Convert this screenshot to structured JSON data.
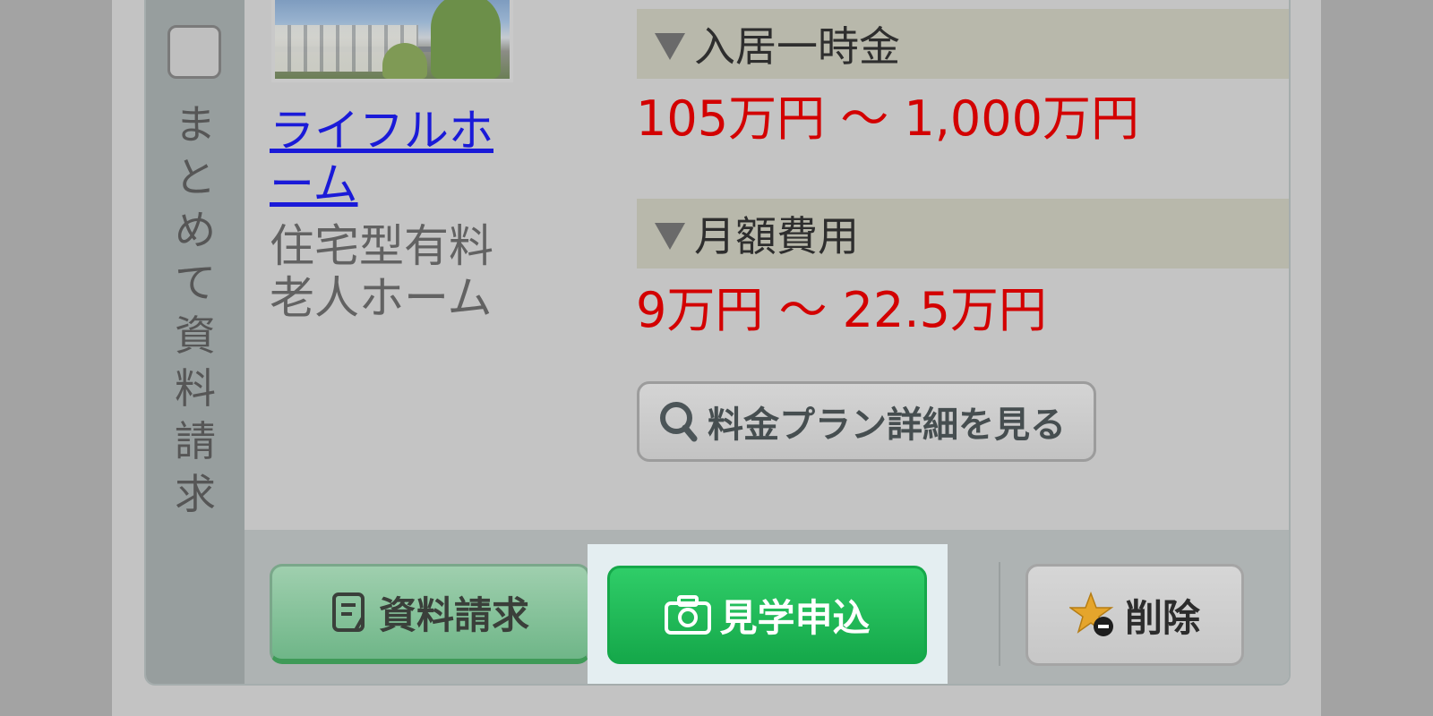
{
  "bulk": {
    "label": "まとめて資料請求"
  },
  "facility": {
    "name": "ライフルホーム",
    "type": "住宅型有料老人ホーム"
  },
  "entrance_fee": {
    "header": "入居一時金",
    "value": "105万円 〜 1,000万円"
  },
  "monthly_fee": {
    "header": "月額費用",
    "value": "9万円 〜 22.5万円"
  },
  "plan_button": {
    "label": "料金プラン詳細を見る"
  },
  "actions": {
    "request_label": "資料請求",
    "visit_label": "見学申込",
    "delete_label": "削除"
  },
  "colors": {
    "price": "#d30000",
    "link": "#1a1ad8",
    "visit_green": "#1fbd58",
    "highlight": "#e4eef1"
  },
  "icons": {
    "request": "document-icon",
    "visit": "camera-icon",
    "delete": "star-minus-icon",
    "plan": "search-icon"
  }
}
